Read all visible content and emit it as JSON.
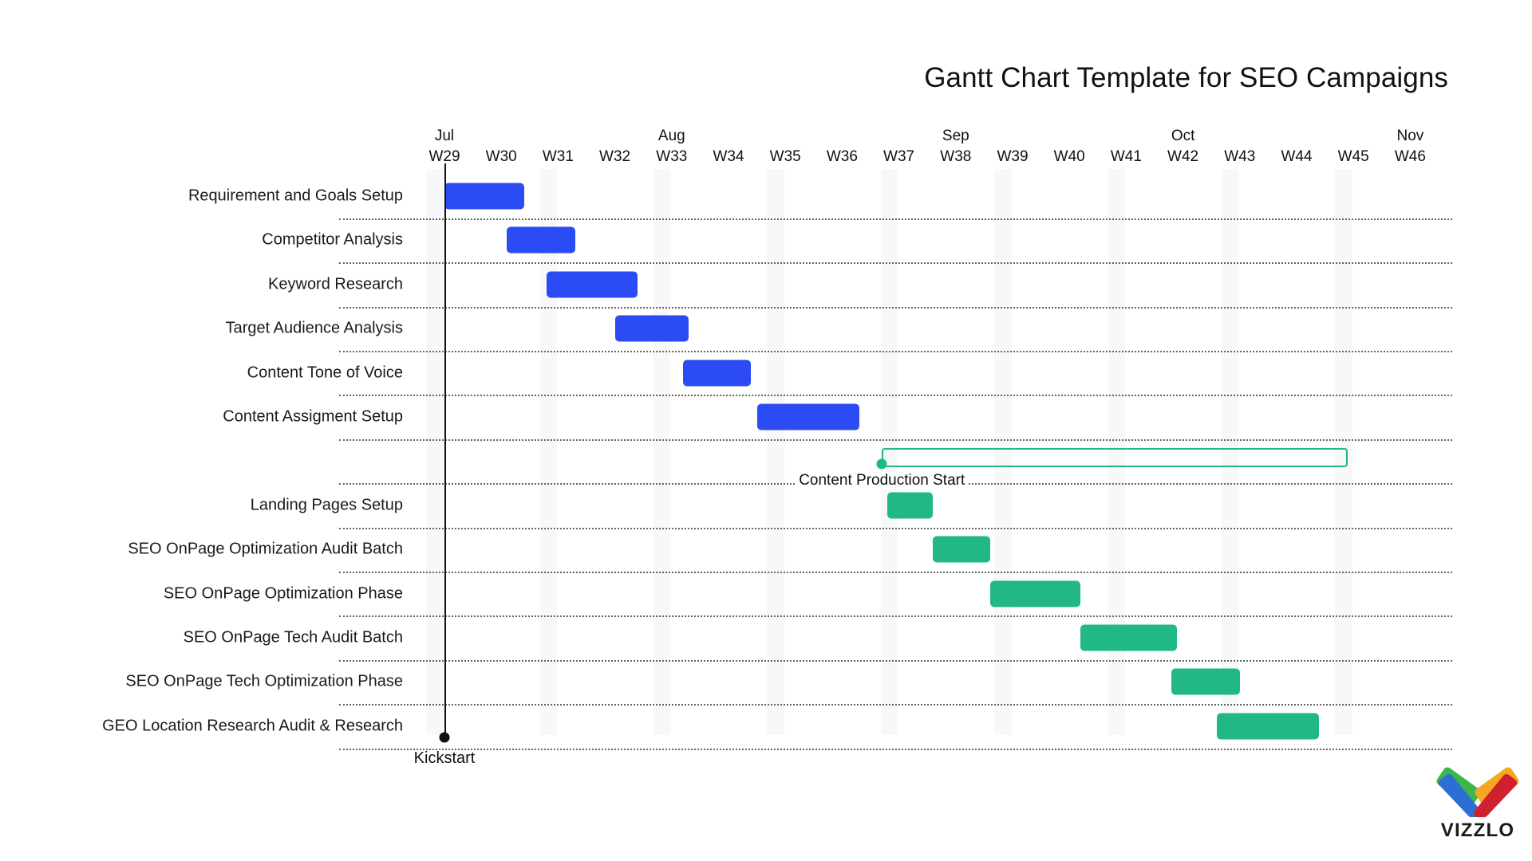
{
  "chart_data": {
    "type": "bar",
    "subtype": "gantt",
    "title": "Gantt Chart Template for SEO Campaigns",
    "xlabel": "",
    "ylabel": "",
    "grid": true,
    "legend": "none",
    "x_axis": {
      "unit": "week",
      "range": [
        "W29",
        "W46"
      ],
      "week_ticks": [
        "W29",
        "W30",
        "W31",
        "W32",
        "W33",
        "W34",
        "W35",
        "W36",
        "W37",
        "W38",
        "W39",
        "W40",
        "W41",
        "W42",
        "W43",
        "W44",
        "W45",
        "W46"
      ],
      "month_ticks": [
        {
          "label": "Jul",
          "week": "W29"
        },
        {
          "label": "Aug",
          "week": "W33"
        },
        {
          "label": "Sep",
          "week": "W38"
        },
        {
          "label": "Oct",
          "week": "W42"
        },
        {
          "label": "Nov",
          "week": "W46"
        }
      ]
    },
    "colors": {
      "phase_one": "#2b4bf5",
      "phase_two": "#22b884",
      "marker": "#111111",
      "stripe": "#f7f8f9"
    },
    "tasks": [
      {
        "label": "Requirement and Goals Setup",
        "start_week": 29.0,
        "end_week": 30.4,
        "color": "#2b4bf5",
        "row": 0
      },
      {
        "label": "Competitor Analysis",
        "start_week": 30.1,
        "end_week": 31.3,
        "color": "#2b4bf5",
        "row": 1
      },
      {
        "label": "Keyword Research",
        "start_week": 30.8,
        "end_week": 32.4,
        "color": "#2b4bf5",
        "row": 2
      },
      {
        "label": "Target Audience Analysis",
        "start_week": 32.0,
        "end_week": 33.3,
        "color": "#2b4bf5",
        "row": 3
      },
      {
        "label": "Content Tone of Voice",
        "start_week": 33.2,
        "end_week": 34.4,
        "color": "#2b4bf5",
        "row": 4
      },
      {
        "label": "Content Assigment Setup",
        "start_week": 34.5,
        "end_week": 36.3,
        "color": "#2b4bf5",
        "row": 5
      },
      {
        "label": "Landing Pages Setup",
        "start_week": 36.8,
        "end_week": 37.6,
        "color": "#22b884",
        "row": 7
      },
      {
        "label": "SEO OnPage Optimization Audit Batch",
        "start_week": 37.6,
        "end_week": 38.6,
        "color": "#22b884",
        "row": 8
      },
      {
        "label": "SEO OnPage Optimization Phase",
        "start_week": 38.6,
        "end_week": 40.2,
        "color": "#22b884",
        "row": 9
      },
      {
        "label": "SEO OnPage Tech Audit Batch",
        "start_week": 40.2,
        "end_week": 41.9,
        "color": "#22b884",
        "row": 10
      },
      {
        "label": "SEO OnPage Tech Optimization Phase",
        "start_week": 41.8,
        "end_week": 43.0,
        "color": "#22b884",
        "row": 11
      },
      {
        "label": "GEO Location Research Audit & Research",
        "start_week": 42.6,
        "end_week": 44.4,
        "color": "#22b884",
        "row": 12
      }
    ],
    "milestones": [
      {
        "label": "Content Production Start",
        "week": 36.7,
        "bracket_end_week": 44.9,
        "color": "#22b884",
        "row": 6
      },
      {
        "label": "Kickstart",
        "week": 29.0,
        "color": "#111111",
        "position": "bottom"
      }
    ]
  },
  "branding": {
    "logo_name": "vizzlo-logo",
    "wordmark": "VIZZLO",
    "logo_colors": [
      "#3cb54a",
      "#f5a623",
      "#2b6fd4",
      "#d0202e"
    ]
  }
}
